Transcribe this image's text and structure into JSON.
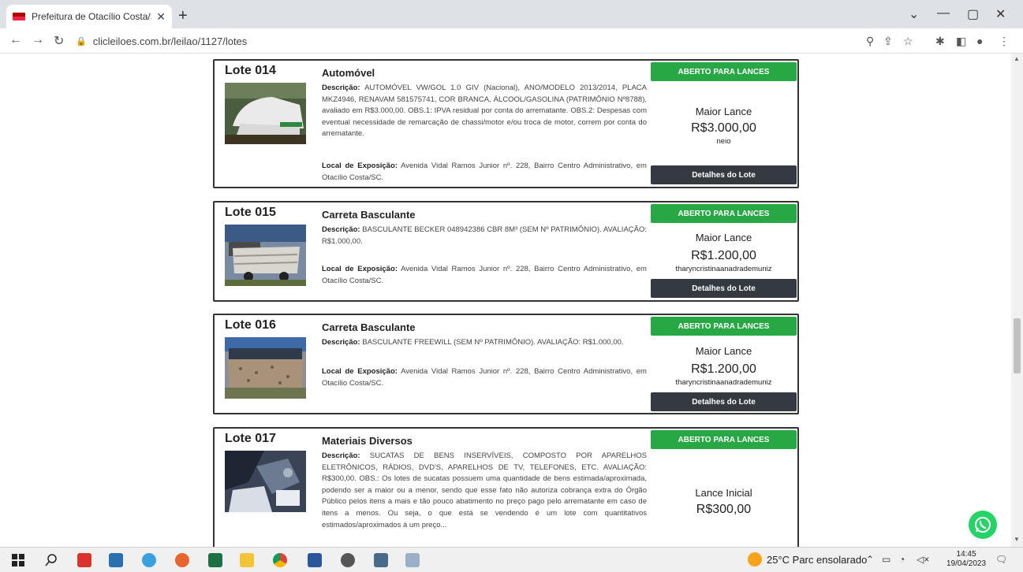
{
  "browser": {
    "tab_title": "Prefeitura de Otacílio Costa/SC :",
    "url": "clicleiloes.com.br/leilao/1127/lotes"
  },
  "lots": [
    {
      "number": "Lote 014",
      "title": "Automóvel",
      "desc_label": "Descrição:",
      "desc": "AUTOMÓVEL VW/GOL 1.0 GIV (Nacional), ANO/MODELO 2013/2014, PLACA MKZ4946, RENAVAM 581575741, COR BRANCA, ÁLCOOL/GASOLINA (PATRIMÔNIO Nº8788), avaliado em R$3.000,00. OBS.1: IPVA residual por conta do arrematante. OBS.2: Despesas com eventual necessidade de remarcação de chassi/motor e/ou troca de motor, correm por conta do arrematante.",
      "local_label": "Local de Exposição:",
      "local": "Avenida Vidal Ramos Junior nº. 228, Bairro Centro Administrativo, em Otacílio Costa/SC.",
      "status": "ABERTO PARA LANCES",
      "bid_label": "Maior Lance",
      "bid_value": "R$3.000,00",
      "bidder": "neio",
      "details": "Detalhes do Lote"
    },
    {
      "number": "Lote 015",
      "title": "Carreta Basculante",
      "desc_label": "Descrição:",
      "desc": "BASCULANTE BECKER 048942386 CBR 8M³ (SEM Nº PATRIMÔNIO). AVALIAÇÃO: R$1.000,00.",
      "local_label": "Local de Exposição:",
      "local": "Avenida Vidal Ramos Junior nº. 228, Bairro Centro Administrativo, em Otacílio Costa/SC.",
      "status": "ABERTO PARA LANCES",
      "bid_label": "Maior Lance",
      "bid_value": "R$1.200,00",
      "bidder": "tharyncristinaanadrademuniz",
      "details": "Detalhes do Lote"
    },
    {
      "number": "Lote 016",
      "title": "Carreta Basculante",
      "desc_label": "Descrição:",
      "desc": "BASCULANTE FREEWILL (SEM Nº PATRIMÔNIO). AVALIAÇÃO: R$1.000,00.",
      "local_label": "Local de Exposição:",
      "local": "Avenida Vidal Ramos Junior nº. 228, Bairro Centro Administrativo, em Otacílio Costa/SC.",
      "status": "ABERTO PARA LANCES",
      "bid_label": "Maior Lance",
      "bid_value": "R$1.200,00",
      "bidder": "tharyncristinaanadrademuniz",
      "details": "Detalhes do Lote"
    },
    {
      "number": "Lote 017",
      "title": "Materiais Diversos",
      "desc_label": "Descrição:",
      "desc": "SUCATAS DE BENS INSERVÍVEIS, COMPOSTO POR APARELHOS ELETRÔNICOS, RÁDIOS, DVD'S, APARELHOS DE TV, TELEFONES, ETC. AVALIAÇÃO: R$300,00. OBS.: Os lotes de sucatas possuem uma quantidade de bens estimada/aproximada, podendo ser a maior ou a menor, sendo que esse fato não autoriza cobrança extra do Órgão Público pelos itens a mais e tão pouco abatimento no preço pago pelo arrematante em caso de itens a menos. Ou seja, o que está se vendendo é um lote com quantitativos estimados/aproximados à um preço...",
      "status": "ABERTO PARA LANCES",
      "bid_label": "Lance Inicial",
      "bid_value": "R$300,00"
    }
  ],
  "taskbar": {
    "weather": "25°C  Parc ensolarado",
    "time": "14:45",
    "date": "19/04/2023"
  }
}
